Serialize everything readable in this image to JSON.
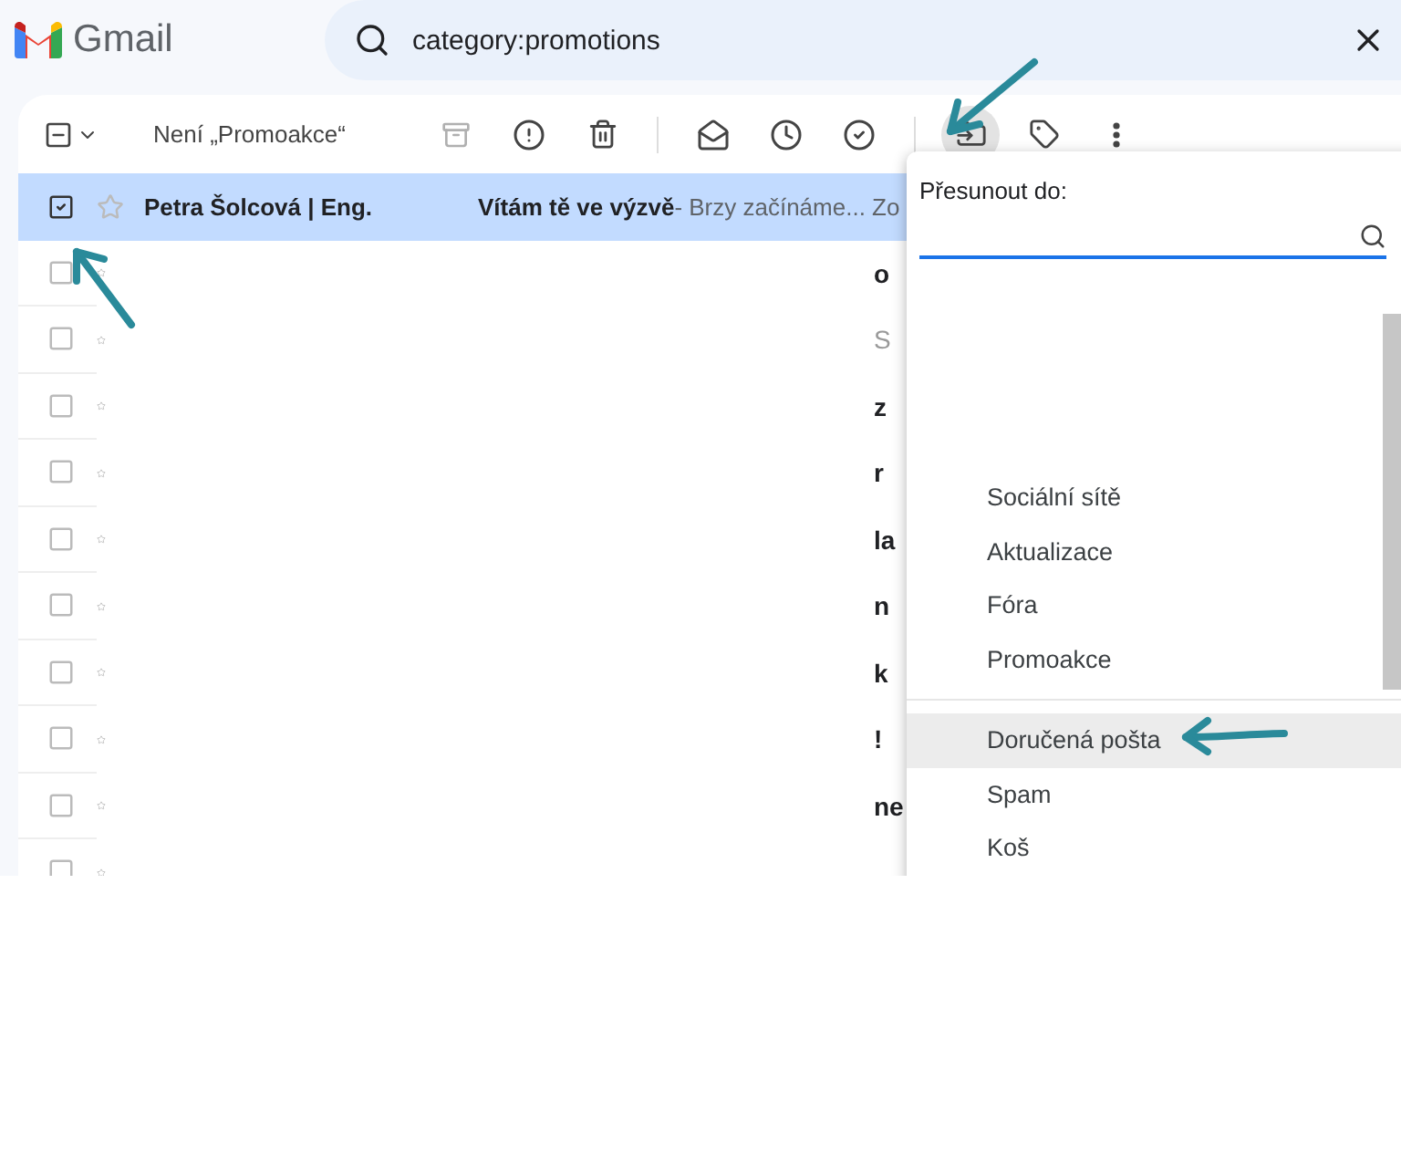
{
  "app": {
    "name": "Gmail"
  },
  "search": {
    "value": "category:promotions"
  },
  "toolbar": {
    "some_selected": true,
    "label": "Není „Promoakce“",
    "buttons": [
      {
        "kind": "archive",
        "disabled": true
      },
      {
        "kind": "spam",
        "disabled": false
      },
      {
        "kind": "delete",
        "disabled": false
      },
      {
        "kind": "divider"
      },
      {
        "kind": "read",
        "disabled": false
      },
      {
        "kind": "snooze",
        "disabled": false
      },
      {
        "kind": "task",
        "disabled": false
      },
      {
        "kind": "divider"
      },
      {
        "kind": "move",
        "disabled": false,
        "active": true
      },
      {
        "kind": "label",
        "disabled": false
      },
      {
        "kind": "more",
        "disabled": false
      }
    ]
  },
  "emails": [
    {
      "selected": true,
      "checked": true,
      "sender": "Petra Šolcová | Eng.",
      "subject": "Vítám tě ve výzvě",
      "snippet": " - Brzy začínáme... Zo"
    },
    {
      "selected": false,
      "checked": false,
      "edge_text": "o",
      "unread": true
    },
    {
      "selected": false,
      "checked": false,
      "edge_text": "S",
      "unread": false
    },
    {
      "selected": false,
      "checked": false,
      "edge_text": "z",
      "unread": true
    },
    {
      "selected": false,
      "checked": false,
      "edge_text": "r",
      "unread": true
    },
    {
      "selected": false,
      "checked": false,
      "edge_text": "la",
      "unread": true
    },
    {
      "selected": false,
      "checked": false,
      "edge_text": "n",
      "unread": true
    },
    {
      "selected": false,
      "checked": false,
      "edge_text": "k",
      "unread": true
    },
    {
      "selected": false,
      "checked": false,
      "edge_text": "!",
      "unread": true
    },
    {
      "selected": false,
      "checked": false,
      "edge_text": "ne",
      "unread": true
    },
    {
      "selected": false,
      "checked": false
    }
  ],
  "move_menu": {
    "title": "Přesunout do:",
    "groups": [
      [
        {
          "label": "Sociální sítě",
          "highlighted": false
        },
        {
          "label": "Aktualizace",
          "highlighted": false
        },
        {
          "label": "Fóra",
          "highlighted": false
        },
        {
          "label": "Promoakce",
          "highlighted": false
        }
      ],
      [
        {
          "label": "Doručená pošta",
          "highlighted": true
        },
        {
          "label": "Spam",
          "highlighted": false
        },
        {
          "label": "Koš",
          "highlighted": false
        }
      ]
    ]
  },
  "annotations": [
    {
      "kind": "arrow"
    },
    {
      "kind": "arrow"
    },
    {
      "kind": "arrow"
    }
  ]
}
